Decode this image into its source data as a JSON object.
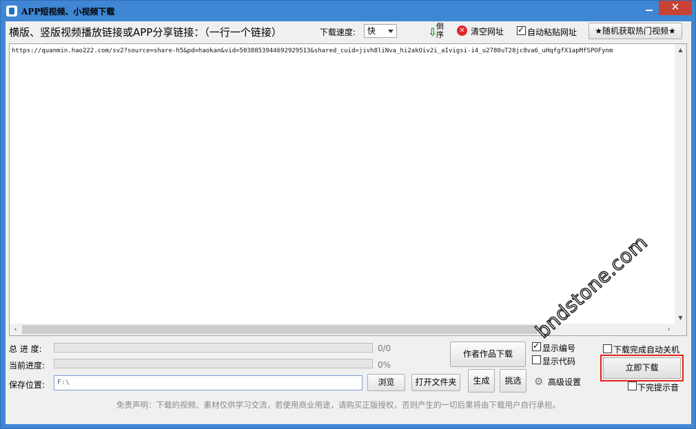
{
  "window": {
    "title": "APP短视频、小视频下载",
    "close_glyph": "✕"
  },
  "toolbar": {
    "link_label": "横版、竖版视频播放链接或APP分享链接：（一行一个链接）",
    "speed_label": "下载速度:",
    "speed_value": "快",
    "reverse_label": "倒序",
    "clear_label": "清空网址",
    "auto_paste_label": "自动粘贴网址",
    "random_hot_label": "★随机获取热门视频★"
  },
  "urls": {
    "text": "https://quanmin.hao222.com/sv2?source=share-h5&pd=haokan&vid=5038853944692929513&shared_cuid=jivh8liNva_hi2akOiv2i_aIvigsi-i4_u2780uT28jc8va6_uHqfgfX1apMfSPOFynm"
  },
  "progress": {
    "total_label": "总 进 度:",
    "total_value": "0/0",
    "total_fraction": 0,
    "current_label": "当前进度:",
    "current_value": "0%",
    "current_fraction": 0
  },
  "save": {
    "label": "保存位置:",
    "path": "F:\\",
    "browse_label": "浏览",
    "open_folder_label": "打开文件夹"
  },
  "actions": {
    "author_works_label": "作者作品下载",
    "generate_label": "生成",
    "pick_label": "挑选",
    "show_number_label": "显示编号",
    "show_code_label": "显示代码",
    "advanced_label": "高级设置",
    "auto_shutdown_label": "下载完成自动关机",
    "download_now_label": "立即下载",
    "done_sound_label": "下完提示音"
  },
  "disclaimer": "免责声明：下载的视频、素材仅供学习交流，若使用商业用途，请购买正版授权，否则产生的一切后果将由下载用户自行承担。",
  "watermark": "bndstone.com"
}
